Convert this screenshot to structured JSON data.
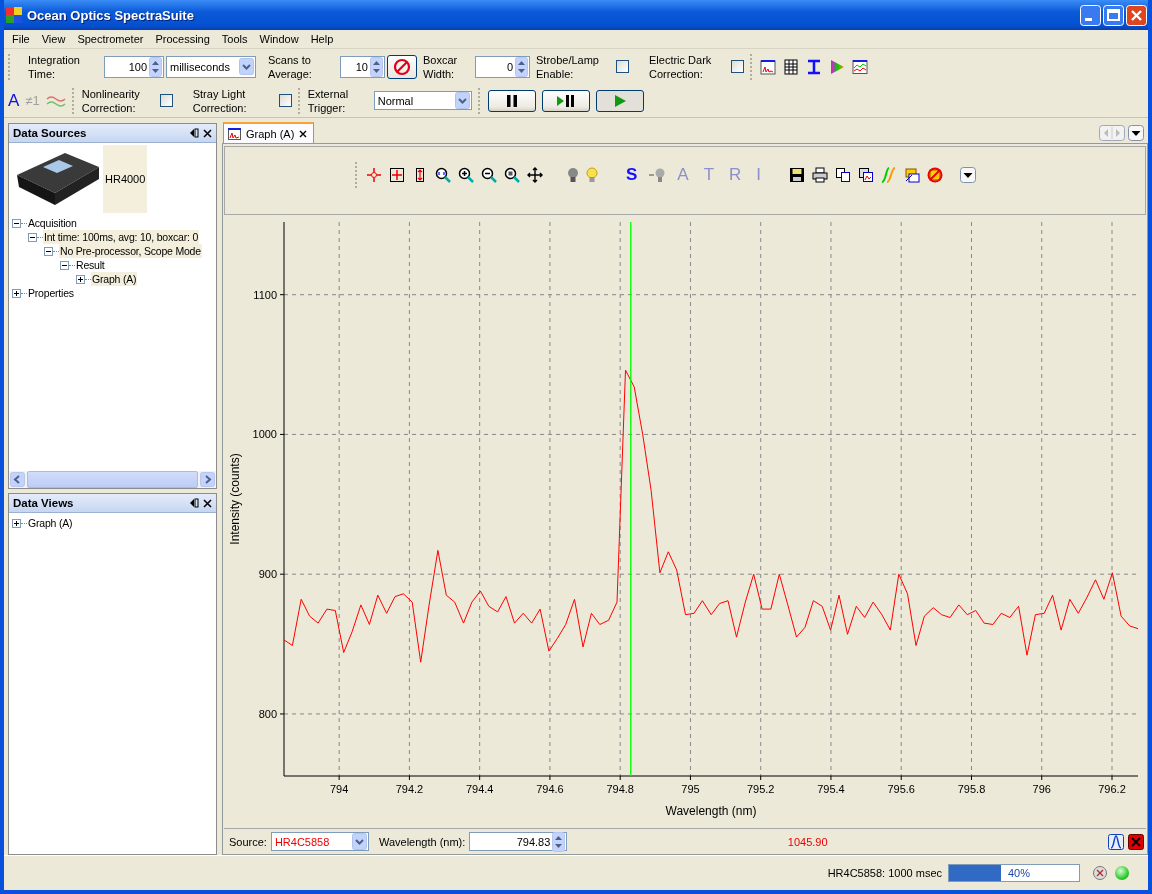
{
  "window": {
    "title": "Ocean Optics SpectraSuite"
  },
  "menu": [
    "File",
    "View",
    "Spectrometer",
    "Processing",
    "Tools",
    "Window",
    "Help"
  ],
  "acquisition_toolbar": {
    "integration": {
      "label": "Integration\nTime:",
      "value": "100",
      "unit": "milliseconds"
    },
    "scans": {
      "label": "Scans to\nAverage:",
      "value": "10"
    },
    "boxcar": {
      "label": "Boxcar\nWidth:",
      "value": "0"
    },
    "strobe": {
      "label": "Strobe/Lamp\nEnable:",
      "checked": false
    },
    "electric_dark": {
      "label": "Electric Dark\nCorrection:",
      "checked": false
    }
  },
  "correction_toolbar": {
    "text_icons": [
      {
        "label": "A",
        "disabled": false
      },
      {
        "label": "≠1",
        "disabled": true
      }
    ],
    "nonlinearity": {
      "label": "Nonlinearity\nCorrection:",
      "checked": false
    },
    "stray_light": {
      "label": "Stray Light\nCorrection:",
      "checked": false
    },
    "trigger": {
      "label": "External\nTrigger:",
      "value": "Normal"
    }
  },
  "data_sources": {
    "title": "Data Sources",
    "device": {
      "name": "HR4000"
    },
    "tree": [
      {
        "label": "Acquisition",
        "expanded": true,
        "highlighted": false,
        "children": [
          {
            "label": "Int time: 100ms, avg: 10, boxcar: 0",
            "expanded": true,
            "highlighted": true,
            "children": [
              {
                "label": "No Pre-processor, Scope Mode",
                "expanded": true,
                "highlighted": true,
                "children": [
                  {
                    "label": "Result",
                    "expanded": true,
                    "highlighted": false,
                    "children": [
                      {
                        "label": "Graph (A)",
                        "expanded": false,
                        "highlighted": true
                      }
                    ]
                  }
                ]
              }
            ]
          }
        ]
      },
      {
        "label": "Properties",
        "expanded": false,
        "highlighted": false
      }
    ]
  },
  "data_views": {
    "title": "Data Views",
    "tree": [
      {
        "label": "Graph (A)",
        "expanded": false,
        "highlighted": false
      }
    ]
  },
  "tabs": [
    {
      "label": "Graph (A)",
      "selected": true
    }
  ],
  "graph_toolbar": {
    "text_icons": [
      {
        "label": "S",
        "disabled": false
      },
      {
        "label": "A",
        "disabled": true
      },
      {
        "label": "T",
        "disabled": true
      },
      {
        "label": "R",
        "disabled": true
      },
      {
        "label": "I",
        "disabled": true
      }
    ]
  },
  "graph": {
    "chart_data": {
      "type": "line",
      "xlabel": "Wavelength (nm)",
      "ylabel": "Intensity (counts)",
      "xlim": [
        793.843,
        796.274
      ],
      "ylim": [
        755.6,
        1152
      ],
      "xticks": [
        794,
        794.2,
        794.4,
        794.6,
        794.8,
        795,
        795.2,
        795.4,
        795.6,
        795.8,
        796,
        796.2
      ],
      "yticks": [
        800,
        900,
        1000,
        1100
      ],
      "grid": true,
      "ref_lines": [
        {
          "axis": "x",
          "value": 794.83,
          "color": "#00ff00"
        }
      ],
      "x": [
        793.843,
        793.867,
        793.892,
        793.916,
        793.94,
        793.965,
        793.989,
        794.013,
        794.037,
        794.062,
        794.086,
        794.11,
        794.135,
        794.159,
        794.183,
        794.208,
        794.232,
        794.256,
        794.281,
        794.305,
        794.329,
        794.354,
        794.378,
        794.402,
        794.426,
        794.451,
        794.475,
        794.499,
        794.524,
        794.548,
        794.572,
        794.597,
        794.621,
        794.645,
        794.67,
        794.694,
        794.718,
        794.742,
        794.767,
        794.791,
        794.815,
        794.84,
        794.864,
        794.888,
        794.913,
        794.937,
        794.961,
        794.986,
        795.01,
        795.034,
        795.059,
        795.083,
        795.107,
        795.131,
        795.156,
        795.18,
        795.204,
        795.229,
        795.253,
        795.277,
        795.302,
        795.326,
        795.35,
        795.375,
        795.399,
        795.423,
        795.447,
        795.472,
        795.496,
        795.52,
        795.545,
        795.569,
        795.593,
        795.618,
        795.642,
        795.666,
        795.691,
        795.715,
        795.739,
        795.764,
        795.788,
        795.812,
        795.836,
        795.861,
        795.885,
        795.909,
        795.934,
        795.958,
        795.982,
        796.007,
        796.031,
        796.055,
        796.08,
        796.104,
        796.128,
        796.153,
        796.177,
        796.201,
        796.226,
        796.25,
        796.274
      ],
      "series": [
        {
          "color": "#ff0000",
          "values": [
            853,
            849,
            882,
            870,
            865,
            875,
            874,
            844,
            859,
            878,
            864,
            885,
            872,
            884,
            886,
            880,
            837,
            878,
            917,
            885,
            880,
            865,
            880,
            888,
            877,
            873,
            884,
            865,
            872,
            865,
            875,
            845,
            854,
            864,
            882,
            848,
            872,
            864,
            867,
            880,
            1046,
            1034,
            1000,
            960,
            901,
            916,
            903,
            871,
            872,
            881,
            871,
            879,
            881,
            855,
            880,
            900,
            875,
            875,
            900,
            878,
            855,
            862,
            881,
            877,
            860,
            885,
            857,
            877,
            869,
            880,
            871,
            860,
            900,
            886,
            849,
            870,
            876,
            871,
            869,
            878,
            871,
            874,
            865,
            864,
            872,
            869,
            877,
            842,
            871,
            872,
            885,
            860,
            882,
            872,
            883,
            896,
            882,
            901,
            870,
            863,
            861
          ]
        }
      ]
    }
  },
  "graph_footer": {
    "source_label": "Source:",
    "source": "HR4C5858",
    "wavelength_label": "Wavelength (nm):",
    "wavelength": "794.83",
    "reading": "1045.90"
  },
  "status_bar": {
    "text": "HR4C5858: 1000 msec",
    "level": 0.4,
    "progress_label": "40%"
  }
}
